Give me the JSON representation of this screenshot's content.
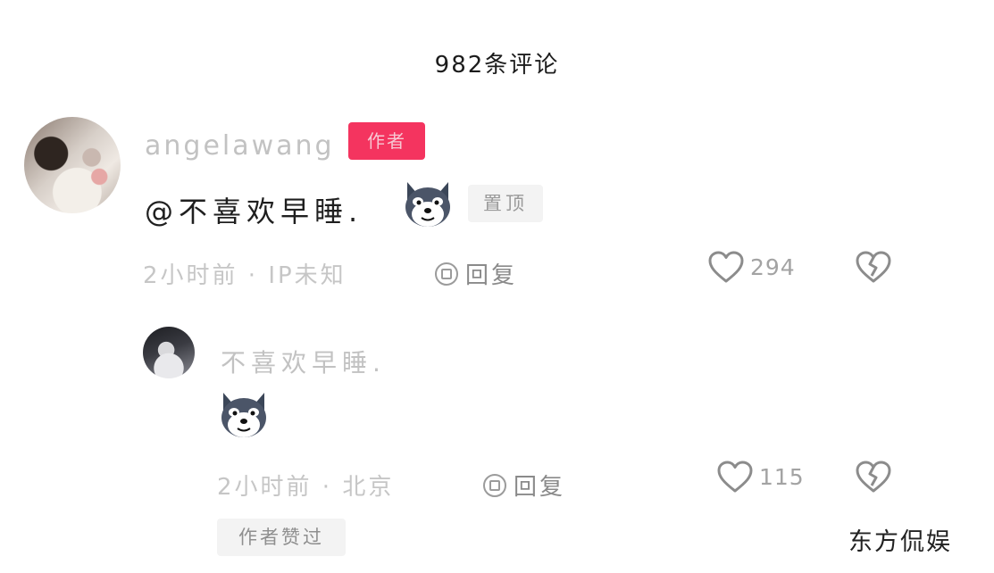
{
  "header": {
    "title": "982条评论"
  },
  "main_comment": {
    "username": "angelawang",
    "author_badge": "作者",
    "text": "@不喜欢早睡.",
    "pin_label": "置顶",
    "meta": "2小时前 · IP未知",
    "reply_label": "回复",
    "like_count": "294"
  },
  "reply_comment": {
    "username": "不喜欢早睡.",
    "meta": "2小时前 · 北京",
    "reply_label": "回复",
    "like_count": "115",
    "liked_by_author": "作者赞过"
  },
  "watermark": "东方侃娱",
  "icons": {
    "like": "heart-outline-icon",
    "dislike": "broken-heart-icon",
    "reply": "reply-icon",
    "emoji": "husky-dog-emoji"
  },
  "colors": {
    "author_badge": "#f4345f",
    "muted_text": "#c2c2c2",
    "badge_bg": "#f3f3f3"
  }
}
